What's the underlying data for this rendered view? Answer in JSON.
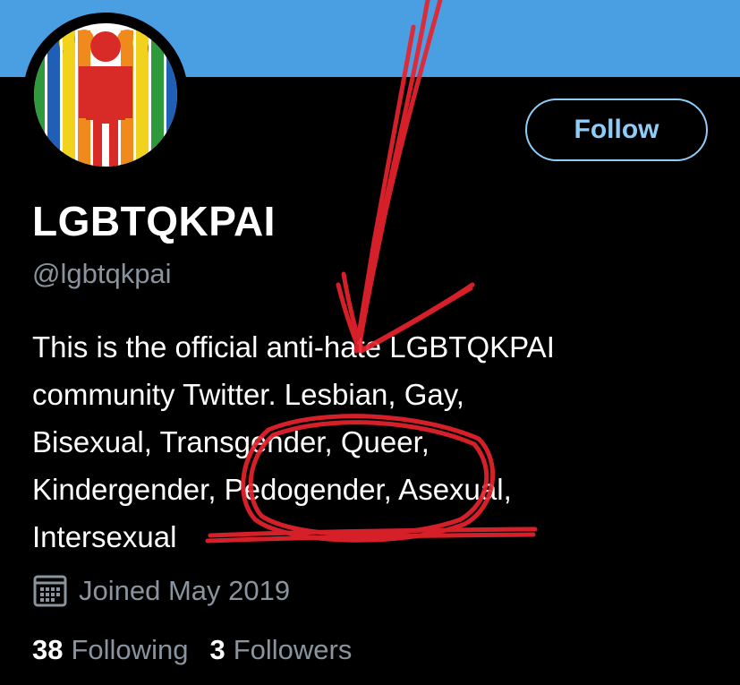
{
  "colors": {
    "banner": "#4a9ee2",
    "background": "#000000",
    "accent": "#8ecdf8",
    "secondary_text": "#8a949e",
    "annotation_red": "#e8232e"
  },
  "avatar": {
    "icon": "rainbow-people-logo-icon"
  },
  "follow_button": {
    "label": "Follow"
  },
  "profile": {
    "display_name": "LGBTQKPAI",
    "handle": "@lgbtqkpai",
    "bio_lines": [
      "This is the official anti-hate LGBTQKPAI",
      "community Twitter. Lesbian, Gay,",
      "Bisexual, Transgender, Queer,",
      "Kindergender, Pedogender, Asexual,",
      "Intersexual"
    ],
    "joined": {
      "icon": "calendar-icon",
      "text": "Joined May 2019"
    }
  },
  "stats": {
    "following_count": "38",
    "following_label": "Following",
    "followers_count": "3",
    "followers_label": "Followers"
  }
}
